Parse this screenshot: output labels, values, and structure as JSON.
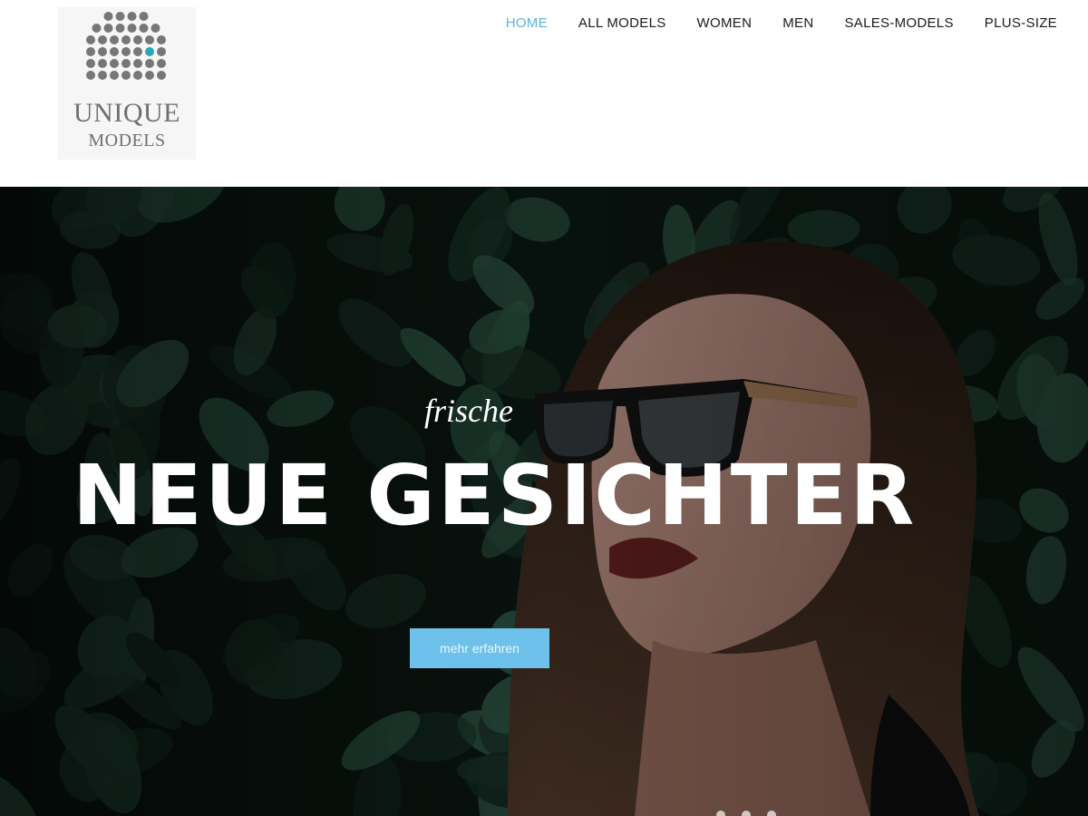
{
  "brand": {
    "line1": "UNIQUE",
    "line2": "MODELS",
    "dot_color": "#777777",
    "accent_dot_color": "#28a7b8"
  },
  "nav": {
    "items": [
      {
        "label": "HOME",
        "active": true
      },
      {
        "label": "ALL MODELS",
        "active": false
      },
      {
        "label": "WOMEN",
        "active": false
      },
      {
        "label": "MEN",
        "active": false
      },
      {
        "label": "SALES-MODELS",
        "active": false
      },
      {
        "label": "PLUS-SIZE",
        "active": false
      }
    ],
    "active_color": "#5bb3e0"
  },
  "hero": {
    "kicker": "frische",
    "title": "NEUE GESICHTER",
    "button_label": "mehr erfahren",
    "button_color": "#6ec1ea",
    "slides": 3
  }
}
